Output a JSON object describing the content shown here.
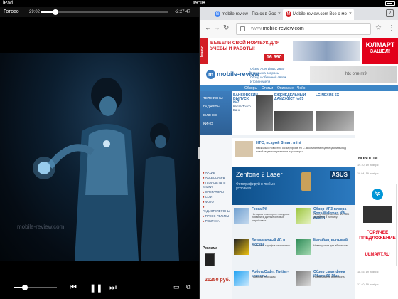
{
  "status": {
    "left": "iPad",
    "time": "19:08",
    "battery": ""
  },
  "video": {
    "done_label": "Готово",
    "elapsed": "29:02",
    "remaining": "-2:27:47",
    "progress": 0.12,
    "volume": 0.25,
    "watermark": "mobile-review.com"
  },
  "browser": {
    "tabs": [
      {
        "title": "mobile-review - Поиск в Goo",
        "icon": "G"
      },
      {
        "title": "Mobile-review.com Все о мо",
        "icon": "M"
      }
    ],
    "url_prefix": "www.",
    "url_host": "mobile-review.com"
  },
  "page": {
    "top_ad": {
      "brand": "lenovo",
      "headline": "ВЫБЕРИ СВОЙ НОУТБУК ДЛЯ УЧЕБЫ И РАБОТЫ!",
      "price": "16 990",
      "store_line1": "ЮЛМАРТ",
      "store_line2": "ЗАШЕЛ!"
    },
    "logo": "mobile-review",
    "header_news": [
      "Обзор Acer Liquid Z630",
      "Ответы на вопросы",
      "Обзор мобильной связи",
      "Итоги недели"
    ],
    "header_ad": "htc one m9",
    "nav": [
      "Обзоры",
      "Статьи",
      "Описание",
      "Чейс"
    ],
    "sidebar_hero": [
      "ТЕЛЕФОНЫ",
      "ГАДЖЕТЫ",
      "БИЗНЕС",
      "КИНО"
    ],
    "sidebar_menu": [
      "АРХИВ",
      "АКСЕССУАРЫ",
      "ПЛАНШЕТЫ И КНИГИ",
      "ОПЕРАТОРЫ",
      "СОФТ",
      "ФОТО",
      "РАДИОТЕЛЕФОНЫ",
      "ПРЕСС-РЕЛИЗЫ",
      "РЕКЛАМА"
    ],
    "sidebar_ad_title": "Реклама",
    "sidebar_ad_price": "21250 руб.",
    "featured": [
      {
        "title": "БАНКОВСКИЙ ВЫПУСК №7",
        "text": "Карта Touch Банк"
      },
      {
        "title": "ЕЖЕНЕДЕЛЬНЫЙ ДАЙДЖЕСТ №75",
        "text": ""
      },
      {
        "title": "LG NEXUS 5X",
        "text": ""
      }
    ],
    "htc_news": {
      "title": "HTC, вскрой Smart mini",
      "body": "Несколько новостей о смартфоне HTC. В компании подтвердили выход новой модели и уточнили параметры."
    },
    "banner": {
      "model": "Zenfone 2 Laser",
      "tagline": "Фотографируй в любых условиях",
      "brand": "ASUS"
    },
    "news": [
      {
        "title": "Гонка Pi!",
        "body": "На одном из интернет-ресурсов появились данные о новых устройствах."
      },
      {
        "title": "Обзор MP3-плеера Sony Walkman NW-A25HN",
        "body": "Плеер Sony Walkman NW-A25 добавили в линейку."
      },
      {
        "title": "Безлимитный 4G в Москве",
        "body": "Стоимость тарифов изменилась."
      },
      {
        "title": "МегаФон, вызывай",
        "body": "Новая услуга для абонентов."
      },
      {
        "title": "РоботоСофт: Twitter-клиенты",
        "body": "Подборка программ."
      },
      {
        "title": "Обзор смартфона iPhone 6S Plus",
        "body": "Новая модель смартфона."
      }
    ],
    "right_header": "НОВОСТИ",
    "hp_ad": {
      "logo": "hp",
      "hot": "ГОРЯЧЕЕ ПРЕДЛОЖЕНИЕ",
      "site": "ULMART.RU"
    },
    "right_news": [
      "19.10, 19 ноября",
      "19.04, 19 ноября",
      "18.45, 19 ноября",
      "17.40, 19 ноября"
    ]
  }
}
